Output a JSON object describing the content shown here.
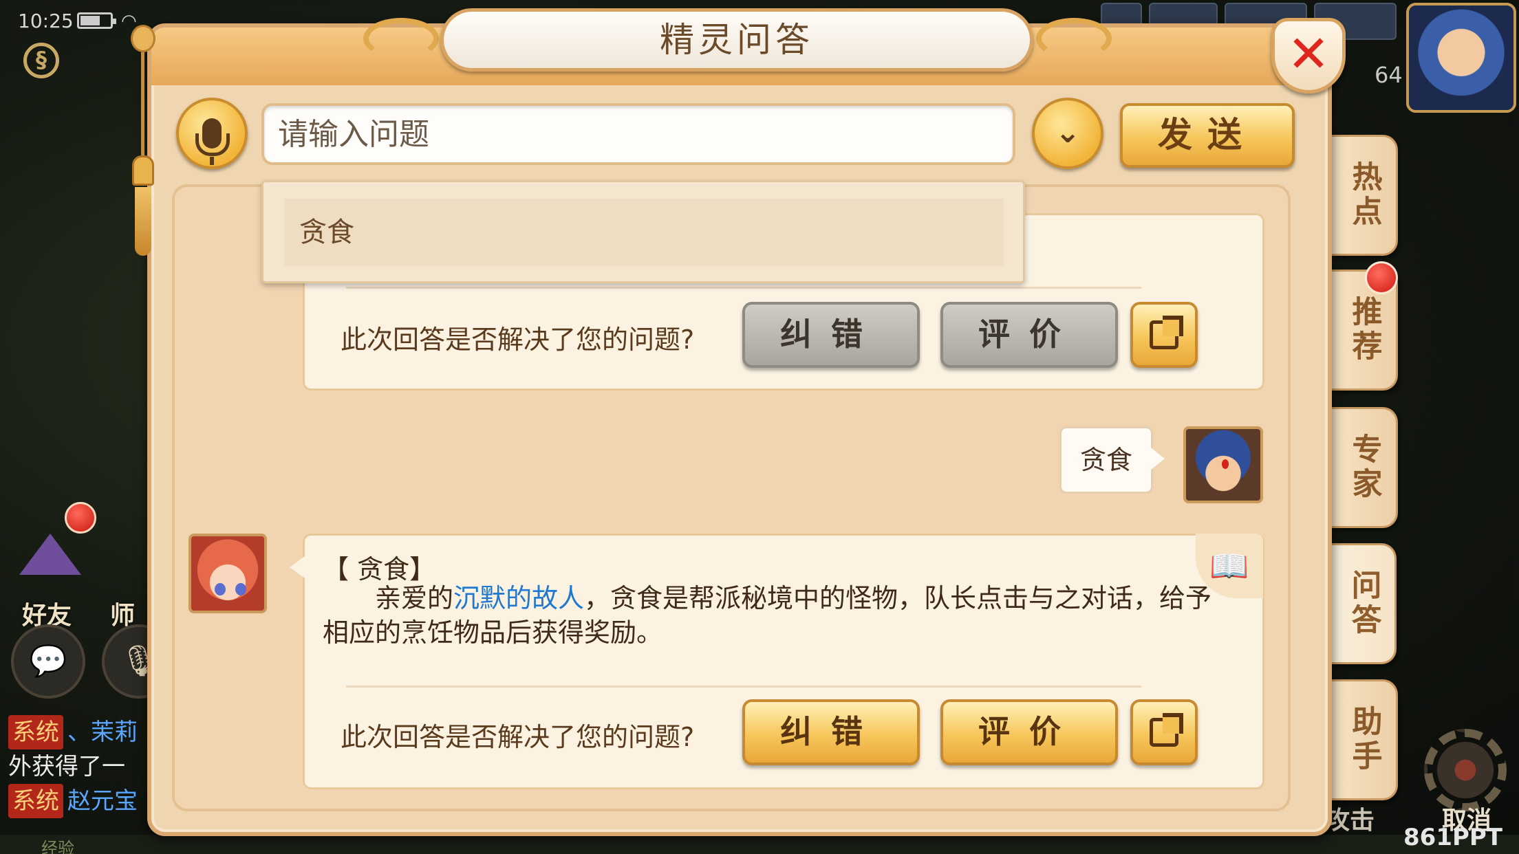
{
  "status_bar": {
    "time": "10:25"
  },
  "hud": {
    "friend_label": "好友",
    "mentor_label": "师",
    "level": "64",
    "cancel_label": "取消",
    "attack_label": "攻击",
    "watermark": "861PPT",
    "chat_lines": [
      {
        "tag": "系统",
        "name": "、茉莉",
        "text": ""
      },
      {
        "tag": "",
        "name": "",
        "text": "外获得了一"
      },
      {
        "tag": "系统",
        "name": "赵元宝",
        "text": ""
      }
    ],
    "bottom_text": "经验"
  },
  "dialog": {
    "title": "精灵问答",
    "close_symbol": "✕",
    "input": {
      "placeholder": "请输入问题",
      "value": ""
    },
    "dropdown_symbol": "⌄",
    "send_label": "发送",
    "suggestions": [
      "贪食"
    ],
    "side_tabs": [
      {
        "label": "热点",
        "active": false
      },
      {
        "label": "推荐",
        "active": false,
        "badge": true
      },
      {
        "label": "专家",
        "active": false
      },
      {
        "label": "问答",
        "active": true
      },
      {
        "label": "助手",
        "active": false
      }
    ],
    "messages": {
      "previous_feedback": {
        "question": "此次回答是否解决了您的问题?",
        "correct_label": "纠错",
        "rate_label": "评价",
        "state": "disabled"
      },
      "user_message": "贪食",
      "answer": {
        "title": "【 贪食】",
        "body_prefix": "亲爱的",
        "link_text": "沉默的故人",
        "body_suffix": "，贪食是帮派秘境中的怪物，队长点击与之对话，给予相应的烹饪物品后获得奖励。",
        "feedback_question": "此次回答是否解决了您的问题?",
        "correct_label": "纠错",
        "rate_label": "评价"
      }
    }
  },
  "colors": {
    "panel_bg": "#f0d6b0",
    "gold_button": "#f6c65a",
    "gray_button": "#a9a59e",
    "close_red": "#e0251c",
    "link_blue": "#1f78d1"
  }
}
